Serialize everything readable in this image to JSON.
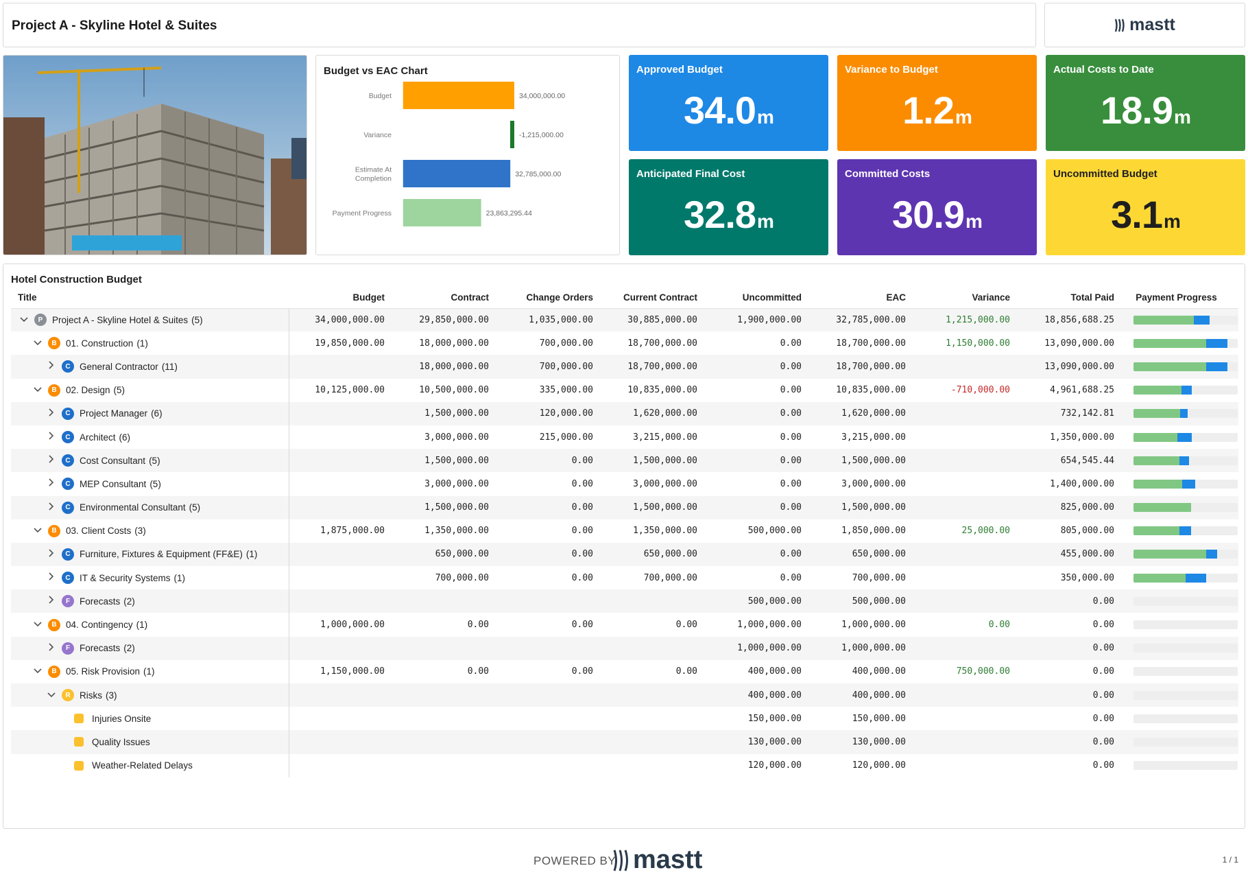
{
  "header": {
    "title": "Project A - Skyline Hotel & Suites",
    "logo_text": "mastt"
  },
  "chart": {
    "title": "Budget vs EAC Chart"
  },
  "chart_data": {
    "type": "bar",
    "orientation": "horizontal",
    "title": "Budget vs EAC Chart",
    "categories": [
      "Budget",
      "Variance",
      "Estimate At Completion",
      "Payment Progress"
    ],
    "values": [
      34000000,
      -1215000,
      32785000,
      23863295.44
    ],
    "value_labels": [
      "34,000,000.00",
      "-1,215,000.00",
      "32,785,000.00",
      "23,863,295.44"
    ],
    "colors": [
      "#ffa000",
      "#1b7a2b",
      "#2f74c8",
      "#9ed59e"
    ],
    "xlim": [
      -1215000,
      34000000
    ]
  },
  "kpis": [
    {
      "label": "Approved Budget",
      "value": "34.0",
      "unit": "m",
      "color": "#1e88e5"
    },
    {
      "label": "Variance to Budget",
      "value": "1.2",
      "unit": "m",
      "color": "#fb8c00"
    },
    {
      "label": "Actual Costs to Date",
      "value": "18.9",
      "unit": "m",
      "color": "#388e3c"
    },
    {
      "label": "Anticipated Final Cost",
      "value": "32.8",
      "unit": "m",
      "color": "#00796b"
    },
    {
      "label": "Committed Costs",
      "value": "30.9",
      "unit": "m",
      "color": "#5e35b1"
    },
    {
      "label": "Uncommitted Budget",
      "value": "3.1",
      "unit": "m",
      "color": "#fdd835"
    }
  ],
  "table": {
    "title": "Hotel Construction Budget",
    "columns": [
      "Title",
      "Budget",
      "Contract",
      "Change Orders",
      "Current Contract",
      "Uncommitted",
      "EAC",
      "Variance",
      "Total Paid",
      "Payment Progress"
    ],
    "rows": [
      {
        "level": 0,
        "chev": "down",
        "badge": "P",
        "title": "Project A - Skyline Hotel & Suites",
        "count": "(5)",
        "budget": "34,000,000.00",
        "contract": "29,850,000.00",
        "change": "1,035,000.00",
        "current": "30,885,000.00",
        "uncommitted": "1,900,000.00",
        "eac": "32,785,000.00",
        "variance": "1,215,000.00",
        "vsign": "pos",
        "paid": "18,856,688.25",
        "prog": [
          0.58,
          0.15
        ]
      },
      {
        "level": 1,
        "chev": "down",
        "badge": "B",
        "title": "01. Construction",
        "count": "(1)",
        "budget": "19,850,000.00",
        "contract": "18,000,000.00",
        "change": "700,000.00",
        "current": "18,700,000.00",
        "uncommitted": "0.00",
        "eac": "18,700,000.00",
        "variance": "1,150,000.00",
        "vsign": "pos",
        "paid": "13,090,000.00",
        "prog": [
          0.7,
          0.2
        ]
      },
      {
        "level": 2,
        "chev": "right",
        "badge": "C",
        "title": "General Contractor",
        "count": "(11)",
        "budget": "",
        "contract": "18,000,000.00",
        "change": "700,000.00",
        "current": "18,700,000.00",
        "uncommitted": "0.00",
        "eac": "18,700,000.00",
        "variance": "",
        "vsign": "",
        "paid": "13,090,000.00",
        "prog": [
          0.7,
          0.2
        ]
      },
      {
        "level": 1,
        "chev": "down",
        "badge": "B",
        "title": "02. Design",
        "count": "(5)",
        "budget": "10,125,000.00",
        "contract": "10,500,000.00",
        "change": "335,000.00",
        "current": "10,835,000.00",
        "uncommitted": "0.00",
        "eac": "10,835,000.00",
        "variance": "-710,000.00",
        "vsign": "neg",
        "paid": "4,961,688.25",
        "prog": [
          0.46,
          0.1
        ]
      },
      {
        "level": 2,
        "chev": "right",
        "badge": "C",
        "title": "Project Manager",
        "count": "(6)",
        "budget": "",
        "contract": "1,500,000.00",
        "change": "120,000.00",
        "current": "1,620,000.00",
        "uncommitted": "0.00",
        "eac": "1,620,000.00",
        "variance": "",
        "vsign": "",
        "paid": "732,142.81",
        "prog": [
          0.45,
          0.07
        ]
      },
      {
        "level": 2,
        "chev": "right",
        "badge": "C",
        "title": "Architect",
        "count": "(6)",
        "budget": "",
        "contract": "3,000,000.00",
        "change": "215,000.00",
        "current": "3,215,000.00",
        "uncommitted": "0.00",
        "eac": "3,215,000.00",
        "variance": "",
        "vsign": "",
        "paid": "1,350,000.00",
        "prog": [
          0.42,
          0.14
        ]
      },
      {
        "level": 2,
        "chev": "right",
        "badge": "C",
        "title": "Cost Consultant",
        "count": "(5)",
        "budget": "",
        "contract": "1,500,000.00",
        "change": "0.00",
        "current": "1,500,000.00",
        "uncommitted": "0.00",
        "eac": "1,500,000.00",
        "variance": "",
        "vsign": "",
        "paid": "654,545.44",
        "prog": [
          0.44,
          0.09
        ]
      },
      {
        "level": 2,
        "chev": "right",
        "badge": "C",
        "title": "MEP Consultant",
        "count": "(5)",
        "budget": "",
        "contract": "3,000,000.00",
        "change": "0.00",
        "current": "3,000,000.00",
        "uncommitted": "0.00",
        "eac": "3,000,000.00",
        "variance": "",
        "vsign": "",
        "paid": "1,400,000.00",
        "prog": [
          0.47,
          0.12
        ]
      },
      {
        "level": 2,
        "chev": "right",
        "badge": "C",
        "title": "Environmental Consultant",
        "count": "(5)",
        "budget": "",
        "contract": "1,500,000.00",
        "change": "0.00",
        "current": "1,500,000.00",
        "uncommitted": "0.00",
        "eac": "1,500,000.00",
        "variance": "",
        "vsign": "",
        "paid": "825,000.00",
        "prog": [
          0.55,
          0.0
        ]
      },
      {
        "level": 1,
        "chev": "down",
        "badge": "B",
        "title": "03. Client Costs",
        "count": "(3)",
        "budget": "1,875,000.00",
        "contract": "1,350,000.00",
        "change": "0.00",
        "current": "1,350,000.00",
        "uncommitted": "500,000.00",
        "eac": "1,850,000.00",
        "variance": "25,000.00",
        "vsign": "pos",
        "paid": "805,000.00",
        "prog": [
          0.44,
          0.11
        ]
      },
      {
        "level": 2,
        "chev": "right",
        "badge": "C",
        "title": "Furniture, Fixtures & Equipment (FF&E)",
        "count": "(1)",
        "budget": "",
        "contract": "650,000.00",
        "change": "0.00",
        "current": "650,000.00",
        "uncommitted": "0.00",
        "eac": "650,000.00",
        "variance": "",
        "vsign": "",
        "paid": "455,000.00",
        "prog": [
          0.7,
          0.1
        ]
      },
      {
        "level": 2,
        "chev": "right",
        "badge": "C",
        "title": "IT & Security Systems",
        "count": "(1)",
        "budget": "",
        "contract": "700,000.00",
        "change": "0.00",
        "current": "700,000.00",
        "uncommitted": "0.00",
        "eac": "700,000.00",
        "variance": "",
        "vsign": "",
        "paid": "350,000.00",
        "prog": [
          0.5,
          0.2
        ]
      },
      {
        "level": 2,
        "chev": "right",
        "badge": "F",
        "title": "Forecasts",
        "count": "(2)",
        "budget": "",
        "contract": "",
        "change": "",
        "current": "",
        "uncommitted": "500,000.00",
        "eac": "500,000.00",
        "variance": "",
        "vsign": "",
        "paid": "0.00",
        "prog": [
          0,
          0
        ]
      },
      {
        "level": 1,
        "chev": "down",
        "badge": "B",
        "title": "04. Contingency",
        "count": "(1)",
        "budget": "1,000,000.00",
        "contract": "0.00",
        "change": "0.00",
        "current": "0.00",
        "uncommitted": "1,000,000.00",
        "eac": "1,000,000.00",
        "variance": "0.00",
        "vsign": "pos",
        "paid": "0.00",
        "prog": [
          0,
          0
        ]
      },
      {
        "level": 2,
        "chev": "right",
        "badge": "F",
        "title": "Forecasts",
        "count": "(2)",
        "budget": "",
        "contract": "",
        "change": "",
        "current": "",
        "uncommitted": "1,000,000.00",
        "eac": "1,000,000.00",
        "variance": "",
        "vsign": "",
        "paid": "0.00",
        "prog": [
          0,
          0
        ]
      },
      {
        "level": 1,
        "chev": "down",
        "badge": "B",
        "title": "05. Risk Provision",
        "count": "(1)",
        "budget": "1,150,000.00",
        "contract": "0.00",
        "change": "0.00",
        "current": "0.00",
        "uncommitted": "400,000.00",
        "eac": "400,000.00",
        "variance": "750,000.00",
        "vsign": "pos",
        "paid": "0.00",
        "prog": [
          0,
          0
        ]
      },
      {
        "level": 2,
        "chev": "down",
        "badge": "R",
        "title": "Risks",
        "count": "(3)",
        "budget": "",
        "contract": "",
        "change": "",
        "current": "",
        "uncommitted": "400,000.00",
        "eac": "400,000.00",
        "variance": "",
        "vsign": "",
        "paid": "0.00",
        "prog": [
          0,
          0
        ]
      },
      {
        "level": 3,
        "chev": "",
        "badge": "sq",
        "title": "Injuries Onsite",
        "count": "",
        "budget": "",
        "contract": "",
        "change": "",
        "current": "",
        "uncommitted": "150,000.00",
        "eac": "150,000.00",
        "variance": "",
        "vsign": "",
        "paid": "0.00",
        "prog": [
          0,
          0
        ]
      },
      {
        "level": 3,
        "chev": "",
        "badge": "sq",
        "title": "Quality Issues",
        "count": "",
        "budget": "",
        "contract": "",
        "change": "",
        "current": "",
        "uncommitted": "130,000.00",
        "eac": "130,000.00",
        "variance": "",
        "vsign": "",
        "paid": "0.00",
        "prog": [
          0,
          0
        ]
      },
      {
        "level": 3,
        "chev": "",
        "badge": "sq",
        "title": "Weather-Related Delays",
        "count": "",
        "budget": "",
        "contract": "",
        "change": "",
        "current": "",
        "uncommitted": "120,000.00",
        "eac": "120,000.00",
        "variance": "",
        "vsign": "",
        "paid": "0.00",
        "prog": [
          0,
          0
        ]
      }
    ]
  },
  "footer": {
    "powered_by": "POWERED BY",
    "logo_text": "mastt",
    "page": "1 / 1"
  },
  "badge_colors": {
    "P": "#8a8f96",
    "B": "#fb8c00",
    "C": "#1e6fc9",
    "F": "#9575cd",
    "R": "#fbc02d"
  }
}
